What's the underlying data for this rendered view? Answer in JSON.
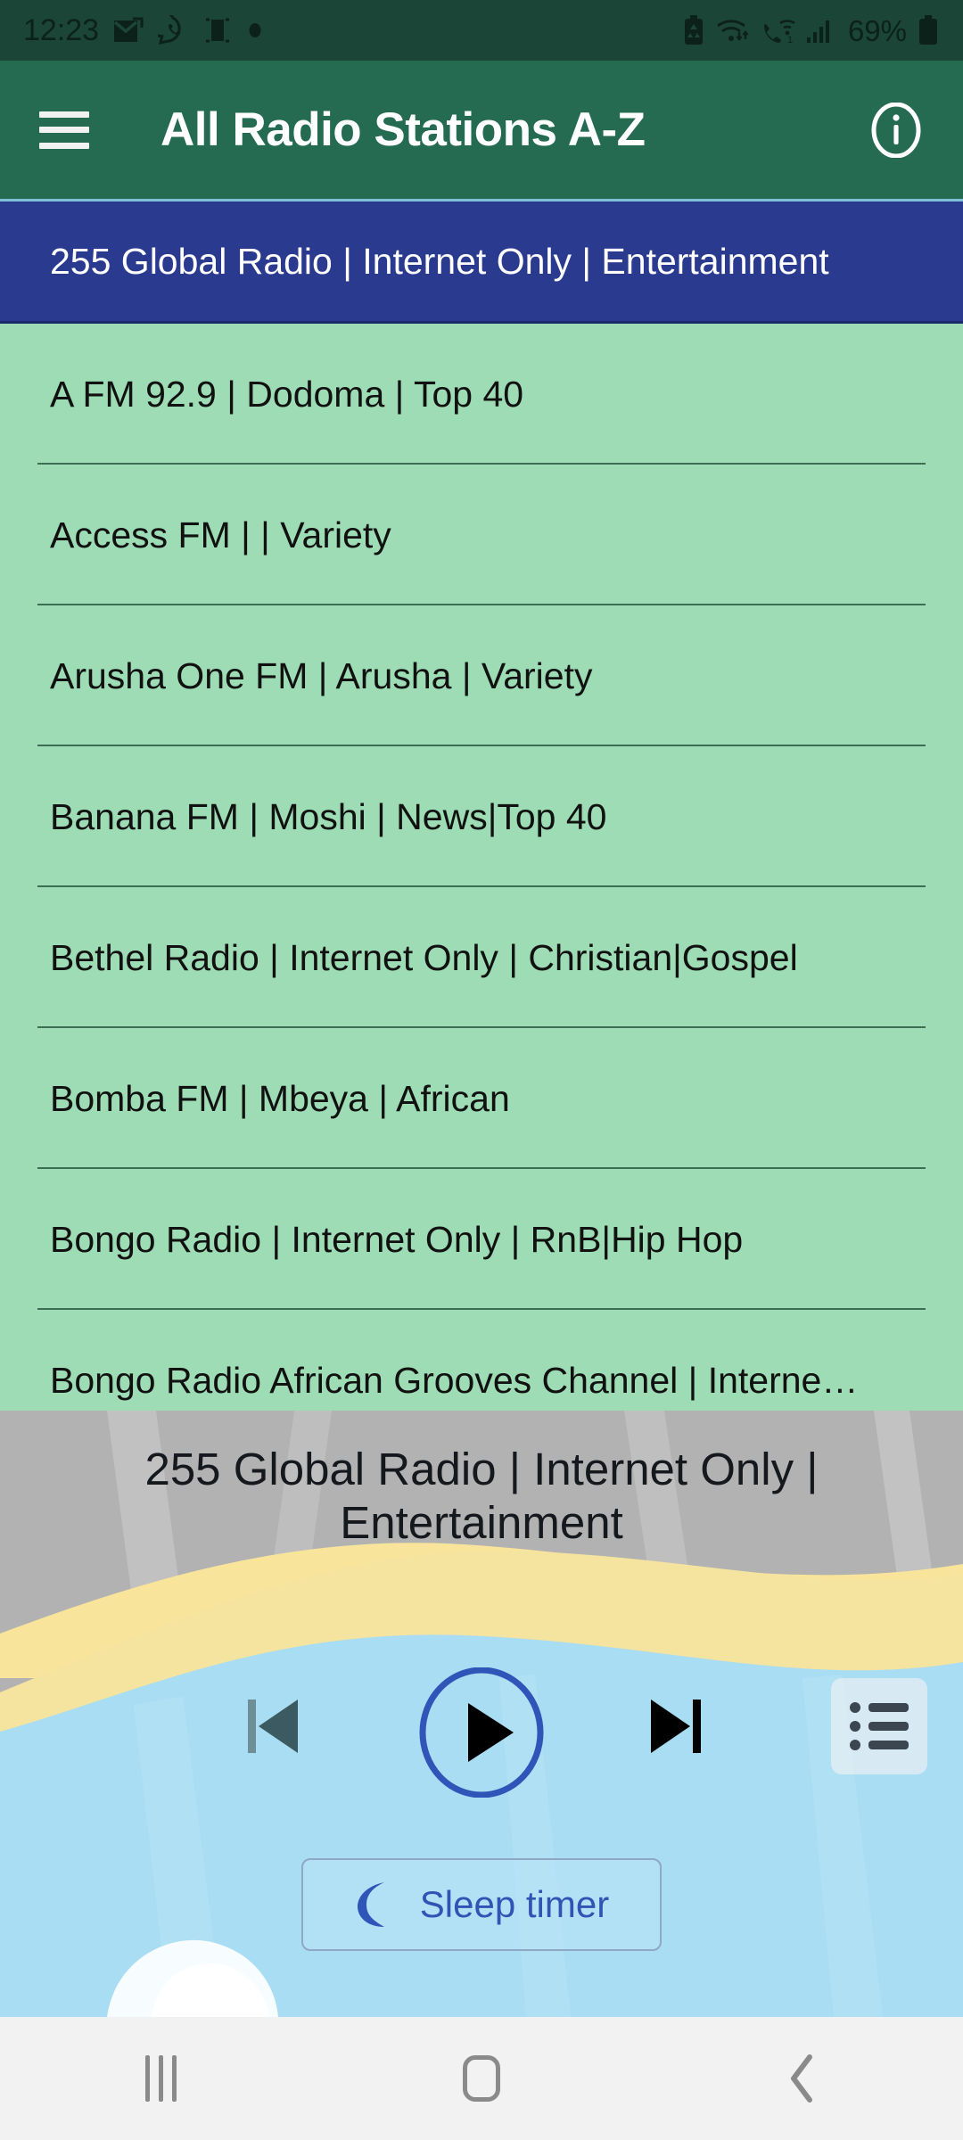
{
  "status_bar": {
    "time": "12:23",
    "battery_percent": "69%",
    "icons": [
      "gmail-icon",
      "whatsapp-icon",
      "screen-mirror-icon",
      "dot-indicator-icon",
      "battery-saver-icon",
      "wifi-data-icon",
      "wifi-calling-icon",
      "cellular-signal-icon",
      "battery-icon"
    ]
  },
  "app_bar": {
    "title": "All Radio Stations A-Z",
    "menu_icon": "hamburger-menu-icon",
    "info_icon": "info-icon"
  },
  "theme": {
    "status_bar_bg": "#1b4537",
    "app_bar_bg": "#256b52",
    "list_bg": "#9ddcb4",
    "selected_row_bg": "#2a3b8f",
    "selected_row_text": "#ffffff",
    "list_text": "#111111",
    "separator": "#3c6e55",
    "accent_blue": "#3054b4",
    "nav_bar_bg": "#f2f2f2"
  },
  "station_list": {
    "rows": [
      {
        "label": "255 Global Radio | Internet Only | Entertainment",
        "selected": true
      },
      {
        "label": "A FM 92.9 | Dodoma | Top 40",
        "selected": false
      },
      {
        "label": "Access FM | | Variety",
        "selected": false
      },
      {
        "label": "Arusha One FM | Arusha | Variety",
        "selected": false
      },
      {
        "label": "Banana FM | Moshi | News|Top 40",
        "selected": false
      },
      {
        "label": "Bethel Radio | Internet Only | Christian|Gospel",
        "selected": false
      },
      {
        "label": "Bomba FM | Mbeya | African",
        "selected": false
      },
      {
        "label": "Bongo Radio | Internet Only | RnB|Hip Hop",
        "selected": false
      },
      {
        "label": "Bongo Radio African Grooves Channel | Interne…",
        "selected": false
      }
    ]
  },
  "player": {
    "now_playing": "255 Global Radio | Internet Only | Entertainment",
    "previous_icon": "skip-previous-icon",
    "play_icon": "play-icon",
    "next_icon": "skip-next-icon",
    "queue_icon": "playlist-queue-icon",
    "sleep_timer_label": "Sleep timer",
    "sleep_timer_icon": "crescent-moon-icon"
  },
  "nav_bar": {
    "recents_icon": "recents-icon",
    "home_icon": "home-icon",
    "back_icon": "back-icon"
  }
}
